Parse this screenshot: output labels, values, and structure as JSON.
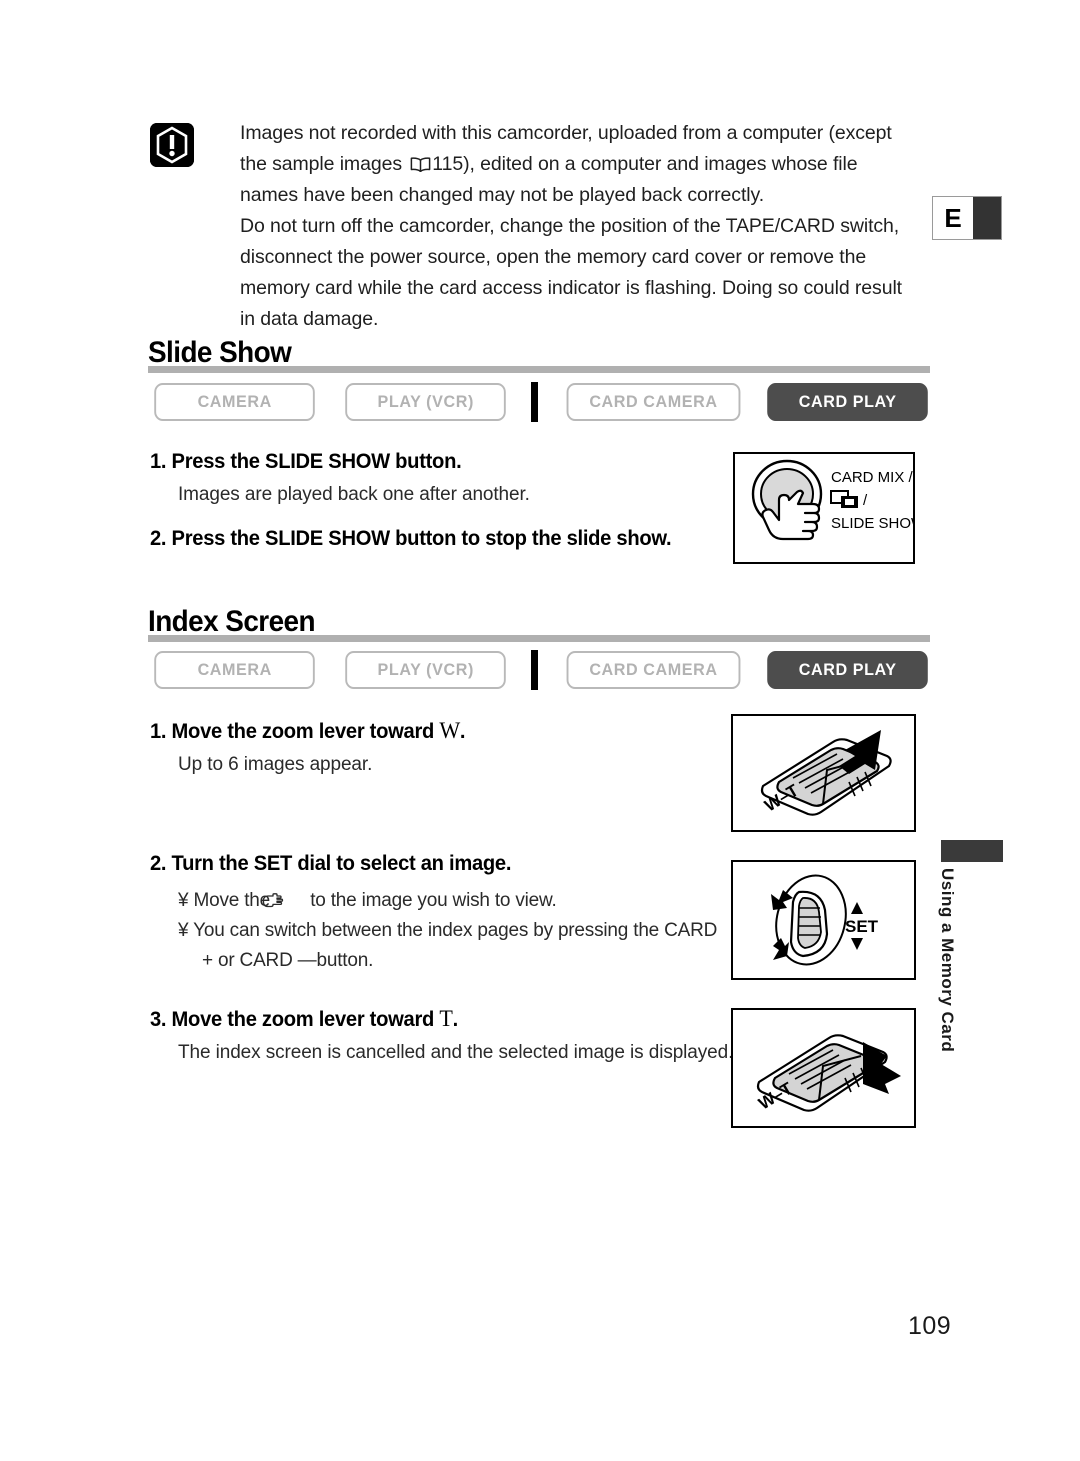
{
  "page": {
    "number": "109",
    "language_tab": "E",
    "chapter_tab": "Using a Memory Card"
  },
  "warning": {
    "icon": "warning-exclamation-icon",
    "paragraph1_part1": "Images not recorded with this camcorder, uploaded from a computer (except the sample images ",
    "book_icon": "open-book-icon",
    "page_ref": "115",
    "paragraph1_part2": "), edited on a computer and images whose file names have been changed may not be played back correctly.",
    "paragraph2": "Do not turn off the camcorder, change the position of the TAPE/CARD switch, disconnect the power source, open the memory card cover or remove the memory card while the card access indicator is flashing. Doing so could result in data damage."
  },
  "modes": {
    "camera": "CAMERA",
    "play_vcr": "PLAY (VCR)",
    "card_camera": "CARD CAMERA",
    "card_play": "CARD PLAY"
  },
  "slide_show": {
    "heading": "Slide Show",
    "step1_title": "1. Press the SLIDE SHOW button.",
    "step1_body": "Images are played back one after another.",
    "step2_title": "2. Press the SLIDE SHOW button to stop the slide show.",
    "illustration": {
      "name": "card-mix-slide-show-button-illustration",
      "label_line1": "CARD MIX /",
      "label_icon": "card-mix-icon",
      "label_slash": "/",
      "label_line3": "SLIDE SHOW"
    }
  },
  "index_screen": {
    "heading": "Index Screen",
    "step1_title_before": "1. Move the zoom lever toward ",
    "step1_title_key": "W",
    "step1_title_after": ".",
    "step1_body": "Up to 6 images appear.",
    "step2_title": "2. Turn the SET dial to select an image.",
    "bullet_marker": "¥",
    "bullet1_before": "Move the ",
    "bullet1_icon": "pointing-hand-icon",
    "bullet1_after": " to the image you wish to view.",
    "bullet2_line1": "You can switch between the index pages by pressing the CARD",
    "bullet2_line2": "+ or CARD —button.",
    "step3_title_before": "3. Move the zoom lever toward ",
    "step3_title_key": "T",
    "step3_title_after": ".",
    "step3_body": "The index screen is cancelled and the selected image is displayed.",
    "illustration_zoom_w": {
      "name": "zoom-lever-toward-w-illustration",
      "label": "W–T"
    },
    "illustration_set_dial": {
      "name": "set-dial-illustration",
      "label": "SET"
    },
    "illustration_zoom_t": {
      "name": "zoom-lever-toward-t-illustration",
      "label": "W–T"
    }
  },
  "colors": {
    "active_pill_bg": "#4d4d4d",
    "inactive_pill_border": "#b9b9b9",
    "inactive_pill_text": "#b2b2b2",
    "heading_rule": "#b0b0b0",
    "tab_dark": "#3a3a3a"
  }
}
